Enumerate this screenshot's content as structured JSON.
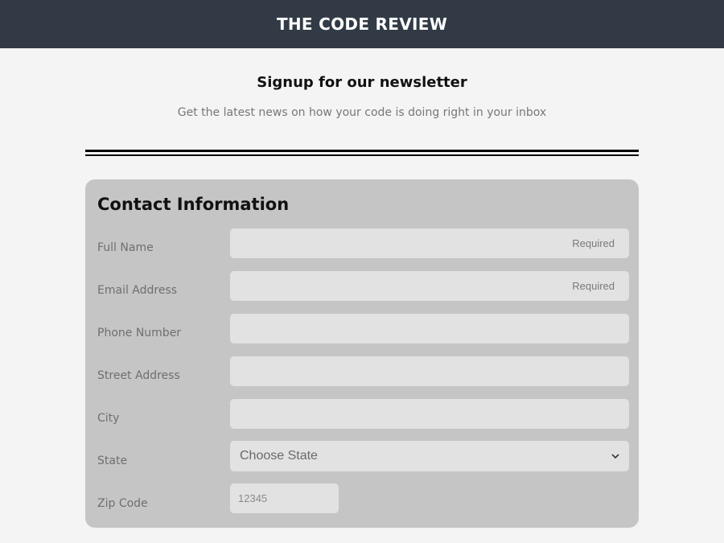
{
  "header": {
    "title": "THE CODE REVIEW"
  },
  "newsletter": {
    "heading": "Signup for our newsletter",
    "subheading": "Get the latest news on how your code is doing right in your inbox"
  },
  "form": {
    "title": "Contact Information",
    "full_name": {
      "label": "Full Name",
      "placeholder": "Required",
      "value": ""
    },
    "email": {
      "label": "Email Address",
      "placeholder": "Required",
      "value": ""
    },
    "phone": {
      "label": "Phone Number",
      "placeholder": "",
      "value": ""
    },
    "street": {
      "label": "Street Address",
      "placeholder": "",
      "value": ""
    },
    "city": {
      "label": "City",
      "placeholder": "",
      "value": ""
    },
    "state": {
      "label": "State",
      "selected": "Choose State"
    },
    "zip": {
      "label": "Zip Code",
      "placeholder": "12345",
      "value": ""
    }
  },
  "colors": {
    "header_bg": "#323b45",
    "card_bg": "#c5c5c5",
    "field_bg": "#e2e2e2",
    "page_bg": "#f4f4f4"
  },
  "icons": {
    "select_arrow": "chevron-down-icon"
  }
}
